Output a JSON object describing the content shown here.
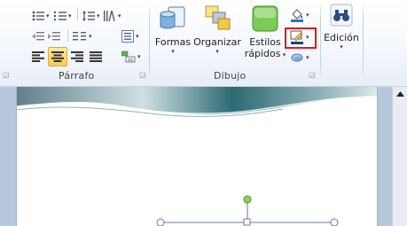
{
  "ribbon": {
    "paragraph_group": {
      "label": "Párrafo"
    },
    "drawing_group": {
      "label": "Dibujo"
    },
    "shapes_button": {
      "label": "Formas"
    },
    "arrange_button": {
      "label": "Organizar"
    },
    "quick_styles_button": {
      "label_line1": "Estilos",
      "label_line2": "rápidos"
    },
    "editing_button": {
      "label": "Edición"
    },
    "highlighted_control": "shape-outline-button",
    "highlight_color": "#e0181d",
    "line_color": "#1f3f8f",
    "fill_color": "#8fd16a"
  },
  "document": {
    "page_background": "#ffffff",
    "canvas_background": "#b7c7dc"
  }
}
